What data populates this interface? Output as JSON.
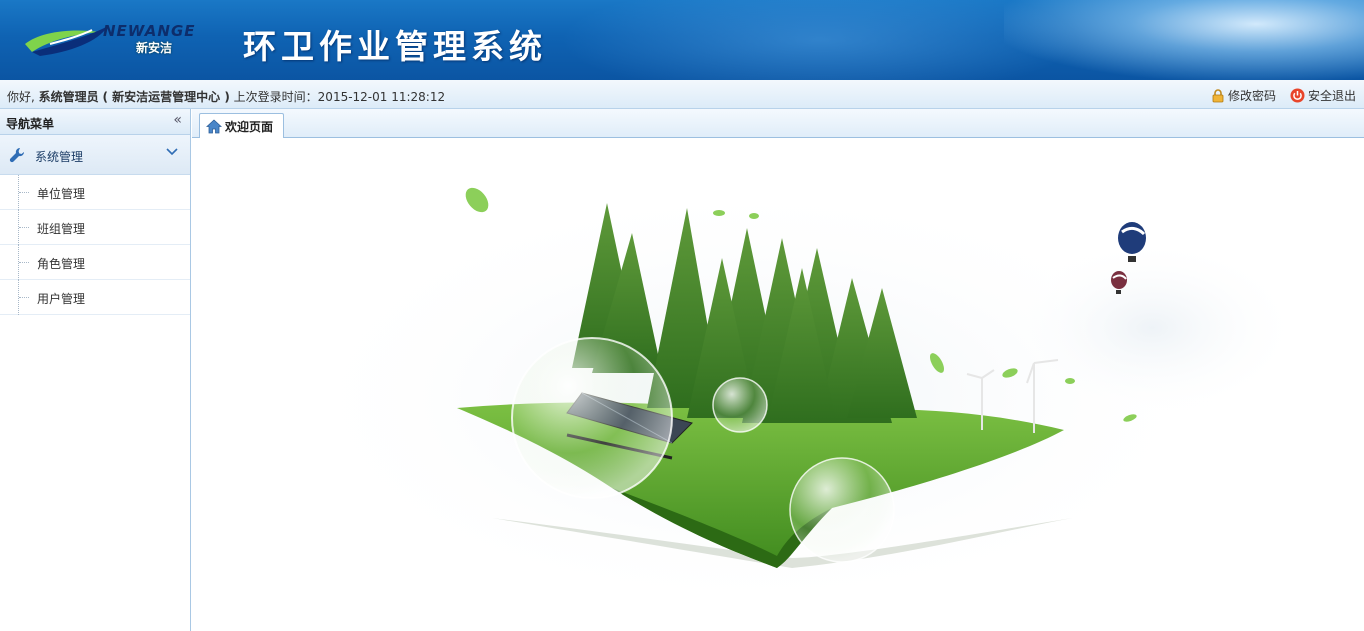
{
  "header": {
    "logo_text": "NEWANGE",
    "logo_subtext": "新安洁",
    "title": "环卫作业管理系统"
  },
  "infobar": {
    "greeting_prefix": "你好,",
    "user_name": "系统管理员",
    "org_name": "( 新安洁运营管理中心 )",
    "last_login_label": "上次登录时间：",
    "last_login_time": "2015-12-01 11:28:12",
    "change_password": "修改密码",
    "logout": "安全退出"
  },
  "sidebar": {
    "title": "导航菜单",
    "groups": [
      {
        "label": "系统管理",
        "items": [
          {
            "label": "单位管理"
          },
          {
            "label": "班组管理"
          },
          {
            "label": "角色管理"
          },
          {
            "label": "用户管理"
          }
        ]
      }
    ]
  },
  "tabs": [
    {
      "label": "欢迎页面"
    }
  ],
  "colors": {
    "header_blue": "#0f63b3",
    "accent_light": "#dcebf8",
    "border": "#9cbfe0"
  }
}
